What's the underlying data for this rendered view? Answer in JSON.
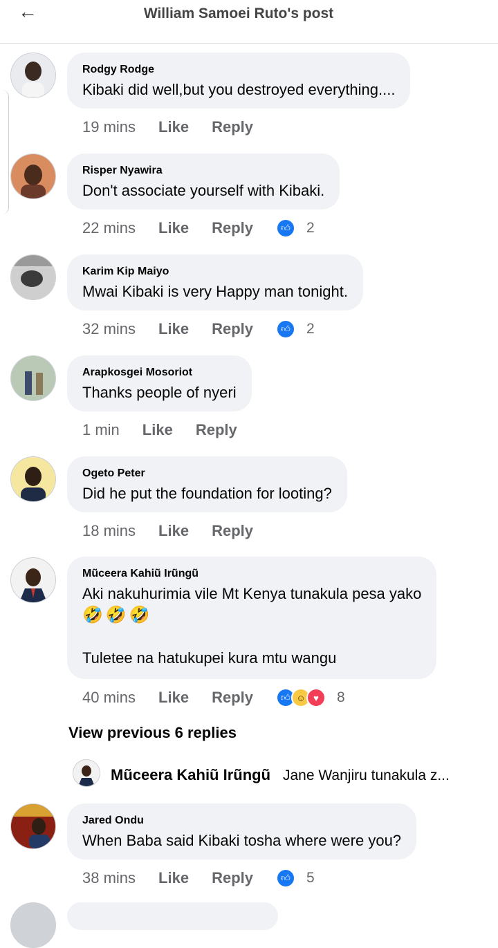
{
  "header": {
    "title": "William Samoei Ruto's post",
    "back_icon": "arrow-left-icon"
  },
  "labels": {
    "like": "Like",
    "reply": "Reply"
  },
  "comments": [
    {
      "author": "Rodgy Rodge",
      "lines": [
        "Kibaki did well,but you destroyed everything...."
      ],
      "time": "19 mins",
      "reactions": [],
      "reaction_count": ""
    },
    {
      "author": "Risper Nyawira",
      "lines": [
        "Don't associate yourself with Kibaki."
      ],
      "time": "22 mins",
      "reactions": [
        "like"
      ],
      "reaction_count": "2"
    },
    {
      "author": "Karim Kip Maiyo",
      "lines": [
        "Mwai Kibaki is very Happy man tonight."
      ],
      "time": "32 mins",
      "reactions": [
        "like"
      ],
      "reaction_count": "2"
    },
    {
      "author": "Arapkosgei Mosoriot",
      "lines": [
        "Thanks people of nyeri"
      ],
      "time": "1 min",
      "reactions": [],
      "reaction_count": ""
    },
    {
      "author": "Ogeto Peter",
      "lines": [
        "Did he put the foundation for looting?"
      ],
      "time": "18 mins",
      "reactions": [],
      "reaction_count": ""
    },
    {
      "author": "Mũceera Kahiũ Irũngũ",
      "lines": [
        "Aki nakuhurimia vile Mt Kenya tunakula pesa yako",
        "",
        "Tuletee na hatukupei kura mtu wangu"
      ],
      "emoji": [
        "🤣",
        "🤣",
        "🤣"
      ],
      "time": "40 mins",
      "reactions": [
        "like",
        "haha",
        "love"
      ],
      "reaction_count": "8"
    },
    {
      "author": "Jared Ondu",
      "lines": [
        "When Baba said Kibaki tosha where were you?"
      ],
      "time": "38 mins",
      "reactions": [
        "like"
      ],
      "reaction_count": "5"
    }
  ],
  "view_previous": "View previous 6 replies",
  "reply_preview": {
    "author": "Mũceera Kahiũ Irũngũ",
    "text": "Jane Wanjiru tunakula z..."
  },
  "colors": {
    "bubble": "#f0f2f5",
    "meta": "#65676b",
    "like_blue": "#1877f2",
    "love_red": "#f33e58",
    "haha_yellow": "#f7c945"
  }
}
